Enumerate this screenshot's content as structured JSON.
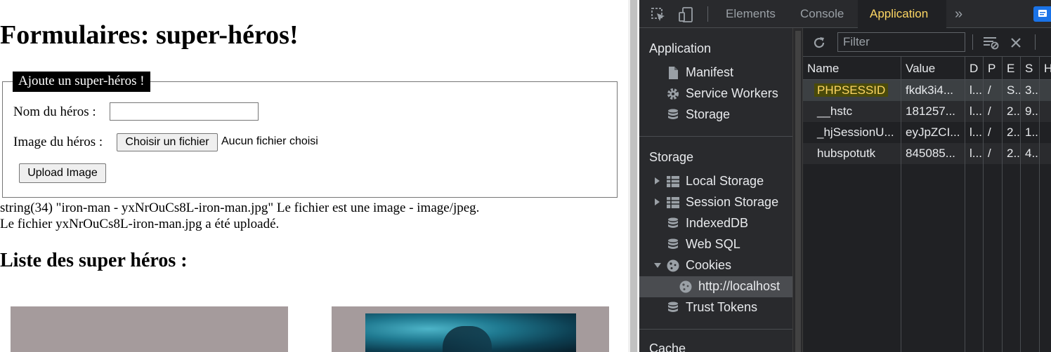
{
  "page": {
    "title": "Formulaires: super-héros!",
    "legend": "Ajoute un super-héros !",
    "name_label": "Nom du héros :",
    "name_value": "",
    "image_label": "Image du héros :",
    "file_button": "Choisir un fichier",
    "file_status": "Aucun fichier choisi",
    "upload_button": "Upload Image",
    "debug_line1": "string(34) \"iron-man - yxNrOuCs8L-iron-man.jpg\" Le fichier est une image - image/jpeg.",
    "debug_line2": "Le fichier yxNrOuCs8L-iron-man.jpg a été uploadé.",
    "list_title": "Liste des super héros :"
  },
  "devtools": {
    "tabs": [
      "Elements",
      "Console",
      "Application",
      "»"
    ],
    "active_tab": "Application",
    "accent": "#fdd663",
    "sidebar": {
      "application_title": "Application",
      "application_items": [
        {
          "label": "Manifest",
          "icon": "file-icon"
        },
        {
          "label": "Service Workers",
          "icon": "gear-icon"
        },
        {
          "label": "Storage",
          "icon": "database-icon"
        }
      ],
      "storage_title": "Storage",
      "storage_items": [
        {
          "label": "Local Storage",
          "icon": "grid-icon",
          "expander": "collapsed"
        },
        {
          "label": "Session Storage",
          "icon": "grid-icon",
          "expander": "collapsed"
        },
        {
          "label": "IndexedDB",
          "icon": "database-icon"
        },
        {
          "label": "Web SQL",
          "icon": "database-icon"
        },
        {
          "label": "Cookies",
          "icon": "cookie-icon",
          "expander": "expanded"
        },
        {
          "label": "http://localhost",
          "icon": "cookie-icon",
          "selected": true
        },
        {
          "label": "Trust Tokens",
          "icon": "database-icon"
        }
      ],
      "cache_title": "Cache"
    },
    "cookies": {
      "filter_placeholder": "Filter",
      "columns": [
        "Name",
        "Value",
        "D",
        "P",
        "E",
        "S",
        "H"
      ],
      "rows": [
        {
          "name": "PHPSESSID",
          "value": "fkdk3i4...",
          "d": "l...",
          "p": "/",
          "e": "S...",
          "s": "3...",
          "selected": true
        },
        {
          "name": "__hstc",
          "value": "181257...",
          "d": "l...",
          "p": "/",
          "e": "2...",
          "s": "9..."
        },
        {
          "name": "_hjSessionU...",
          "value": "eyJpZCI...",
          "d": "l...",
          "p": "/",
          "e": "2...",
          "s": "1..."
        },
        {
          "name": "hubspotutk",
          "value": "845085...",
          "d": "l...",
          "p": "/",
          "e": "2...",
          "s": "4..."
        }
      ]
    }
  }
}
